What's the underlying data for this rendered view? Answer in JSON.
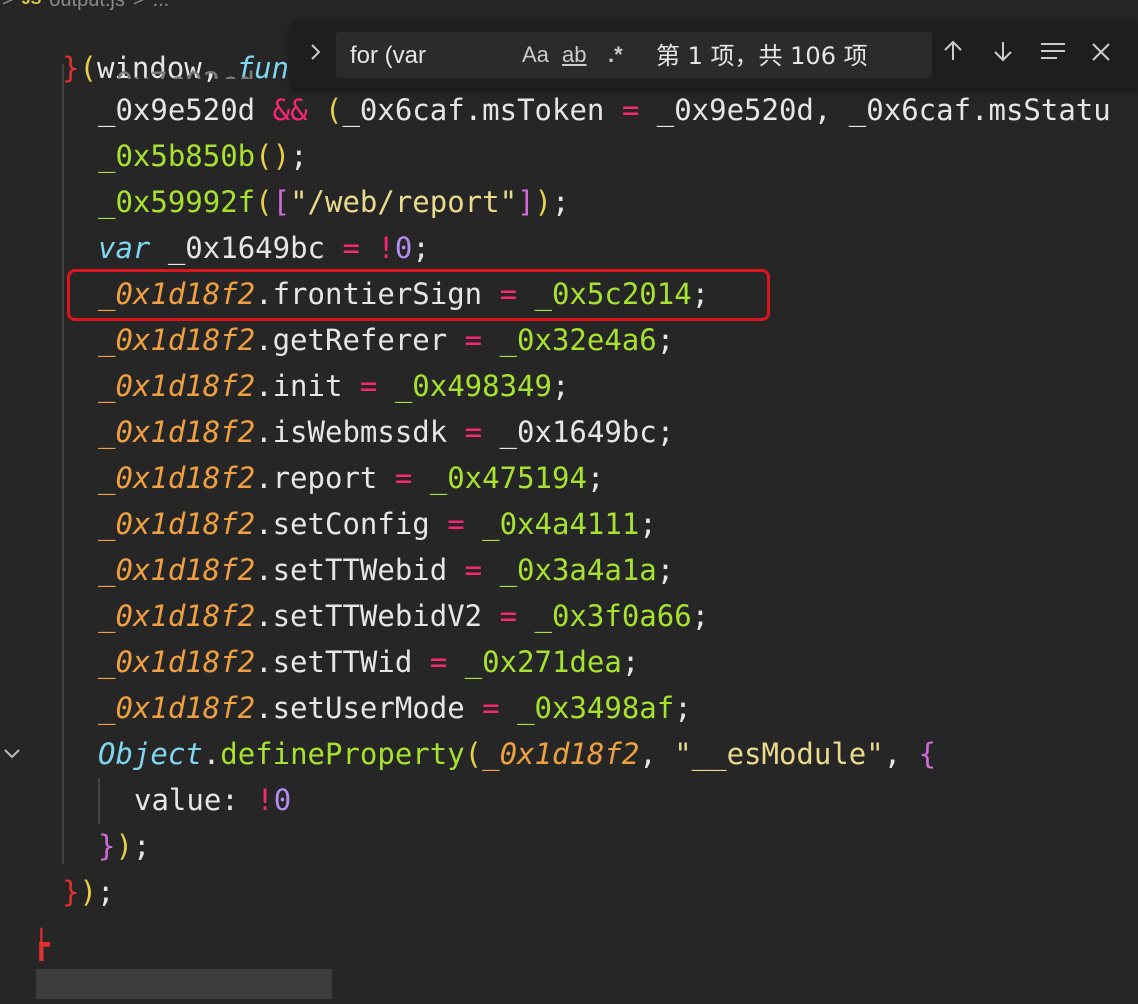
{
  "breadcrumb": {
    "badge": "JS",
    "file": "output.js",
    "sep": ">",
    "more": "..."
  },
  "find_widget": {
    "query": "for (var",
    "match_case_label": "Aa",
    "whole_word_label": "ab",
    "regex_label": ".*",
    "result_count": "第 1 项，共 106 项"
  },
  "code": {
    "line0_partial": "_0x7c02cd",
    "line0": [
      [
        "}",
        "c-brace-r"
      ],
      [
        "(",
        "c-brace-y"
      ],
      [
        "window, ",
        "c-plain"
      ],
      [
        "fun",
        "c-var"
      ]
    ],
    "line1": [
      [
        "_0x9e520d ",
        "c-plain"
      ],
      [
        "&&",
        "c-op"
      ],
      [
        " ",
        "c-plain"
      ],
      [
        "(",
        "c-brace-y"
      ],
      [
        "_0x6caf.msToken ",
        "c-plain"
      ],
      [
        "=",
        "c-op"
      ],
      [
        " _0x9e520d, _0x6caf.msStatu",
        "c-plain"
      ]
    ],
    "line2": [
      [
        "_0x5b850b",
        "c-fn"
      ],
      [
        "()",
        "c-brace-y"
      ],
      [
        ";",
        "c-plain"
      ]
    ],
    "line3": [
      [
        "_0x59992f",
        "c-fn"
      ],
      [
        "(",
        "c-brace-y"
      ],
      [
        "[",
        "c-brace-p"
      ],
      [
        "\"/web/report\"",
        "c-str"
      ],
      [
        "]",
        "c-brace-p"
      ],
      [
        ")",
        "c-brace-y"
      ],
      [
        ";",
        "c-plain"
      ]
    ],
    "line4": [
      [
        "var",
        "c-var"
      ],
      [
        " _0x1649bc ",
        "c-plain"
      ],
      [
        "=",
        "c-op"
      ],
      [
        " ",
        "c-plain"
      ],
      [
        "!",
        "c-op"
      ],
      [
        "0",
        "c-num"
      ],
      [
        ";",
        "c-plain"
      ]
    ],
    "line5": [
      [
        "_0x1d18f2",
        "c-obj"
      ],
      [
        ".frontierSign ",
        "c-plain"
      ],
      [
        "=",
        "c-op"
      ],
      [
        " ",
        "c-plain"
      ],
      [
        "_0x5c2014",
        "c-fn"
      ],
      [
        ";",
        "c-plain"
      ]
    ],
    "line6": [
      [
        "_0x1d18f2",
        "c-obj"
      ],
      [
        ".getReferer ",
        "c-plain"
      ],
      [
        "=",
        "c-op"
      ],
      [
        " ",
        "c-plain"
      ],
      [
        "_0x32e4a6",
        "c-fn"
      ],
      [
        ";",
        "c-plain"
      ]
    ],
    "line7": [
      [
        "_0x1d18f2",
        "c-obj"
      ],
      [
        ".init ",
        "c-plain"
      ],
      [
        "=",
        "c-op"
      ],
      [
        " ",
        "c-plain"
      ],
      [
        "_0x498349",
        "c-fn"
      ],
      [
        ";",
        "c-plain"
      ]
    ],
    "line8": [
      [
        "_0x1d18f2",
        "c-obj"
      ],
      [
        ".isWebmssdk ",
        "c-plain"
      ],
      [
        "=",
        "c-op"
      ],
      [
        " _0x1649bc;",
        "c-plain"
      ]
    ],
    "line9": [
      [
        "_0x1d18f2",
        "c-obj"
      ],
      [
        ".report ",
        "c-plain"
      ],
      [
        "=",
        "c-op"
      ],
      [
        " ",
        "c-plain"
      ],
      [
        "_0x475194",
        "c-fn"
      ],
      [
        ";",
        "c-plain"
      ]
    ],
    "line10": [
      [
        "_0x1d18f2",
        "c-obj"
      ],
      [
        ".setConfig ",
        "c-plain"
      ],
      [
        "=",
        "c-op"
      ],
      [
        " ",
        "c-plain"
      ],
      [
        "_0x4a4111",
        "c-fn"
      ],
      [
        ";",
        "c-plain"
      ]
    ],
    "line11": [
      [
        "_0x1d18f2",
        "c-obj"
      ],
      [
        ".setTTWebid ",
        "c-plain"
      ],
      [
        "=",
        "c-op"
      ],
      [
        " ",
        "c-plain"
      ],
      [
        "_0x3a4a1a",
        "c-fn"
      ],
      [
        ";",
        "c-plain"
      ]
    ],
    "line12": [
      [
        "_0x1d18f2",
        "c-obj"
      ],
      [
        ".setTTWebidV2 ",
        "c-plain"
      ],
      [
        "=",
        "c-op"
      ],
      [
        " ",
        "c-plain"
      ],
      [
        "_0x3f0a66",
        "c-fn"
      ],
      [
        ";",
        "c-plain"
      ]
    ],
    "line13": [
      [
        "_0x1d18f2",
        "c-obj"
      ],
      [
        ".setTTWid ",
        "c-plain"
      ],
      [
        "=",
        "c-op"
      ],
      [
        " ",
        "c-plain"
      ],
      [
        "_0x271dea",
        "c-fn"
      ],
      [
        ";",
        "c-plain"
      ]
    ],
    "line14": [
      [
        "_0x1d18f2",
        "c-obj"
      ],
      [
        ".setUserMode ",
        "c-plain"
      ],
      [
        "=",
        "c-op"
      ],
      [
        " ",
        "c-plain"
      ],
      [
        "_0x3498af",
        "c-fn"
      ],
      [
        ";",
        "c-plain"
      ]
    ],
    "line15": [
      [
        "Object",
        "c-type"
      ],
      [
        ".",
        "c-plain"
      ],
      [
        "defineProperty",
        "c-fn"
      ],
      [
        "(",
        "c-brace-y"
      ],
      [
        "_0x1d18f2",
        "c-obj"
      ],
      [
        ", ",
        "c-plain"
      ],
      [
        "\"__esModule\"",
        "c-str"
      ],
      [
        ", ",
        "c-plain"
      ],
      [
        "{",
        "c-brace-p"
      ]
    ],
    "line16": [
      [
        "value: ",
        "c-plain"
      ],
      [
        "!",
        "c-op"
      ],
      [
        "0",
        "c-num"
      ]
    ],
    "line17": [
      [
        "}",
        "c-brace-p"
      ],
      [
        ")",
        "c-brace-y"
      ],
      [
        ";",
        "c-plain"
      ]
    ],
    "line18": [
      [
        "}",
        "c-brace-r"
      ],
      [
        ")",
        "c-brace-y"
      ],
      [
        ";",
        "c-plain"
      ]
    ]
  }
}
